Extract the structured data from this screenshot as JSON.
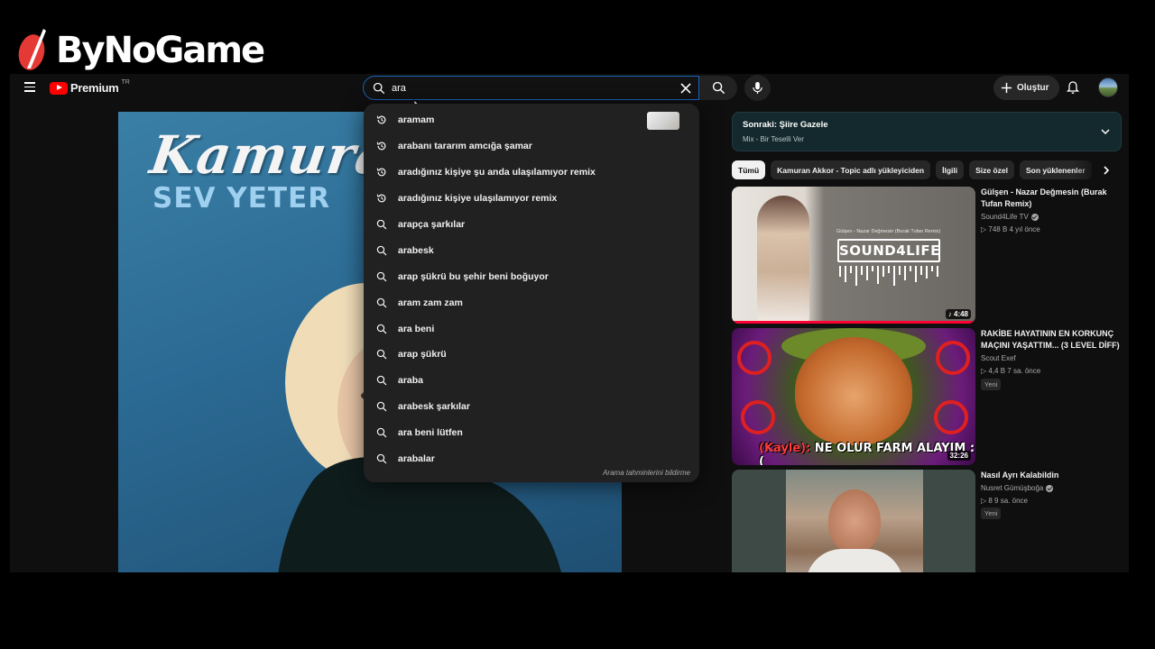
{
  "watermark": {
    "text": "ByNoGame"
  },
  "header": {
    "logo_text": "Premium",
    "logo_superscript": "TR",
    "search_value": "ara",
    "create_label": "Oluştur"
  },
  "player": {
    "cover_artist": "Kamura",
    "cover_title": "SEV YETER"
  },
  "suggestions": {
    "items": [
      {
        "text": "aramam",
        "type": "history"
      },
      {
        "text": "arabanı tararım amcığa şamar",
        "type": "history"
      },
      {
        "text": "aradığınız kişiye şu anda ulaşılamıyor remix",
        "type": "history"
      },
      {
        "text": "aradığınız kişiye ulaşılamıyor remix",
        "type": "history"
      },
      {
        "text": "arapça şarkılar",
        "type": "search"
      },
      {
        "text": "arabesk",
        "type": "search"
      },
      {
        "text": "arap şükrü bu şehir beni boğuyor",
        "type": "search"
      },
      {
        "text": "aram zam zam",
        "type": "search"
      },
      {
        "text": "ara beni",
        "type": "search"
      },
      {
        "text": "arap şükrü",
        "type": "search"
      },
      {
        "text": "araba",
        "type": "search"
      },
      {
        "text": "arabesk şarkılar",
        "type": "search"
      },
      {
        "text": "ara beni lütfen",
        "type": "search"
      },
      {
        "text": "arabalar",
        "type": "search"
      }
    ],
    "footer": "Arama tahminlerini bildirme"
  },
  "up_next": {
    "title": "Sonraki: Şiire Gazele",
    "subtitle": "Mix - Bir Teselli Ver"
  },
  "chips": [
    "Tümü",
    "Kamuran Akkor - Topic adlı yükleyiciden",
    "İlgili",
    "Size özel",
    "Son yüklenenler"
  ],
  "videos": [
    {
      "title": "Gülşen - Nazar Değmesin (Burak Tufan Remix)",
      "channel": "Sound4Life TV",
      "verified": true,
      "meta": "▷ 748 B  4 yıl önce",
      "badge": "",
      "duration": "♪ 4:48",
      "thumb_logo": "SOUND4LIFE",
      "thumb_caption": "Gülşen - Nazar Değmesin (Burak Tufan Remix)"
    },
    {
      "title": "RAKİBE HAYATININ EN KORKUNÇ MAÇINI YAŞATTIM... (3 LEVEL DİFF)",
      "channel": "Scout Exef",
      "verified": false,
      "meta": "▷ 4,4 B  7 sa. önce",
      "badge": "Yeni",
      "duration": "32:26",
      "thumb_banner_a": "(Kayle):",
      "thumb_banner_b": " NE OLUR FARM ALAYIM :("
    },
    {
      "title": "Nasıl Ayrı Kalabildin",
      "channel": "Nusret Gümüşboğa",
      "verified": true,
      "meta": "▷ 8  9 sa. önce",
      "badge": "Yeni",
      "duration": ""
    }
  ]
}
